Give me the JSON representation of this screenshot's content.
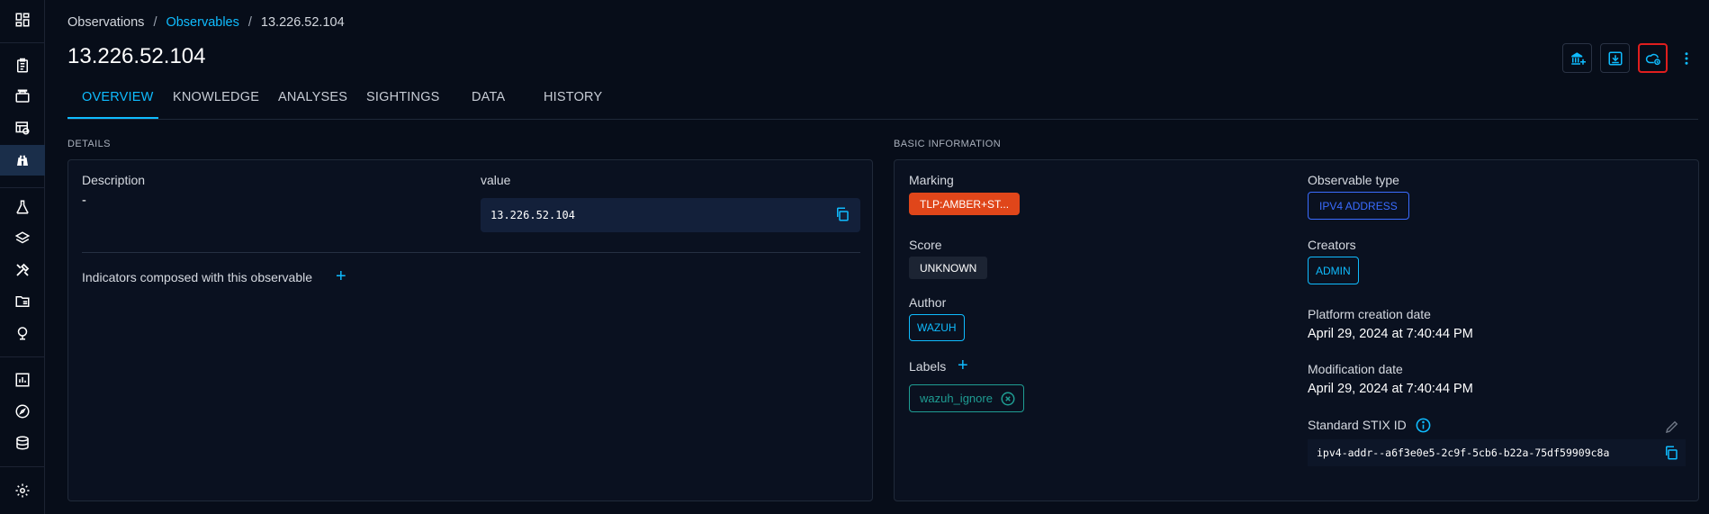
{
  "nav": {
    "icons": [
      "dashboard-icon",
      "reports-icon",
      "cases-icon",
      "events-icon",
      "observations-icon",
      "threats-icon",
      "arsenal-icon",
      "techniques-icon",
      "entities-icon",
      "locations-icon",
      "analytics-icon",
      "explore-icon",
      "data-icon",
      "settings-icon"
    ]
  },
  "breadcrumb": {
    "root": "Observations",
    "sep1": "/",
    "section": "Observables",
    "sep2": "/",
    "current": "13.226.52.104"
  },
  "title": "13.226.52.104",
  "actions": [
    "enrich-button",
    "export-button",
    "cloud-sync-button",
    "more-button"
  ],
  "tabs": [
    {
      "label": "OVERVIEW",
      "active": true
    },
    {
      "label": "KNOWLEDGE",
      "active": false
    },
    {
      "label": "ANALYSES",
      "active": false
    },
    {
      "label": "SIGHTINGS",
      "active": false
    },
    {
      "label": "DATA",
      "active": false
    },
    {
      "label": "HISTORY",
      "active": false
    }
  ],
  "details": {
    "section_title": "DETAILS",
    "description_label": "Description",
    "description_value": "-",
    "value_label": "value",
    "value": "13.226.52.104",
    "indicators_label": "Indicators composed with this observable"
  },
  "basic": {
    "section_title": "BASIC INFORMATION",
    "marking_label": "Marking",
    "marking_value": "TLP:AMBER+ST...",
    "score_label": "Score",
    "score_value": "UNKNOWN",
    "author_label": "Author",
    "author_value": "WAZUH",
    "labels_label": "Labels",
    "label_chip": "wazuh_ignore",
    "observable_type_label": "Observable type",
    "observable_type_value": "IPV4 ADDRESS",
    "creators_label": "Creators",
    "creators_value": "ADMIN",
    "platform_creation_label": "Platform creation date",
    "platform_creation_value": "April 29, 2024 at 7:40:44 PM",
    "modification_label": "Modification date",
    "modification_value": "April 29, 2024 at 7:40:44 PM",
    "stix_label": "Standard STIX ID",
    "stix_value": "ipv4-addr--a6f3e0e5-2c9f-5cb6-b22a-75df59909c8a"
  },
  "colors": {
    "accent": "#0fbcff",
    "marking": "#e0461a",
    "highlight": "#e01e1e",
    "label_teal": "#1f9d93",
    "type_blue": "#3a6cff"
  }
}
